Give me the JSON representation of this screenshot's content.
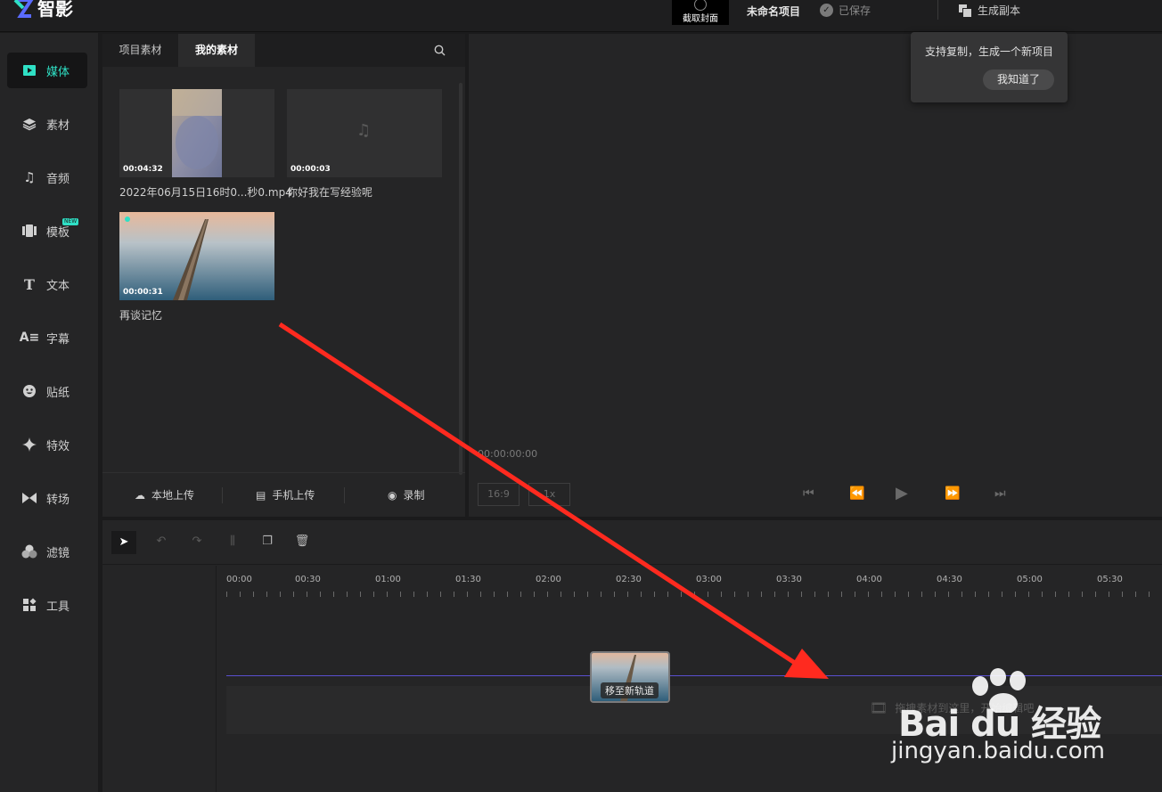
{
  "app": {
    "name": "智影",
    "cover_button": "截取封面",
    "project_name": "未命名项目",
    "saved_status": "已保存",
    "duplicate_label": "生成副本"
  },
  "tooltip": {
    "text": "支持复制，生成一个新项目",
    "confirm": "我知道了"
  },
  "sidebar": {
    "items": [
      {
        "label": "媒体",
        "icon": "play-icon",
        "active": true
      },
      {
        "label": "素材",
        "icon": "layers-icon"
      },
      {
        "label": "音频",
        "icon": "music-note-icon"
      },
      {
        "label": "模板",
        "icon": "template-icon",
        "badge": "NEW"
      },
      {
        "label": "文本",
        "icon": "text-icon"
      },
      {
        "label": "字幕",
        "icon": "subtitle-icon"
      },
      {
        "label": "贴纸",
        "icon": "sticker-icon"
      },
      {
        "label": "特效",
        "icon": "sparkle-icon"
      },
      {
        "label": "转场",
        "icon": "transition-icon"
      },
      {
        "label": "滤镜",
        "icon": "filter-icon"
      },
      {
        "label": "工具",
        "icon": "tools-icon"
      }
    ]
  },
  "media": {
    "tabs": [
      "项目素材",
      "我的素材"
    ],
    "active_tab": "我的素材",
    "items": [
      {
        "duration": "00:04:32",
        "name": "2022年06月15日16时0...秒0.mp4",
        "type": "video"
      },
      {
        "duration": "00:00:03",
        "name": "你好我在写经验呢",
        "type": "audio"
      },
      {
        "duration": "00:00:31",
        "name": "再谈记忆",
        "type": "video"
      }
    ],
    "upload": {
      "local": "本地上传",
      "phone": "手机上传",
      "record": "录制"
    }
  },
  "preview": {
    "timecode": "00:00:00:00",
    "ratio": "16:9",
    "zoom": "1x"
  },
  "timeline": {
    "ruler": [
      "00:00",
      "00:30",
      "01:00",
      "01:30",
      "02:00",
      "02:30",
      "03:00",
      "03:30",
      "04:00",
      "04:30",
      "05:00",
      "05:30"
    ],
    "drag_tag": "移至新轨道",
    "drop_hint": "拖拽素材到这里，开始编辑吧"
  },
  "watermark": {
    "brand": "Bai du 经验",
    "url": "jingyan.baidu.com"
  },
  "colors": {
    "accent": "#2fe0c5",
    "arrow": "#ff2a1f",
    "track_line": "#5a4fcf"
  }
}
